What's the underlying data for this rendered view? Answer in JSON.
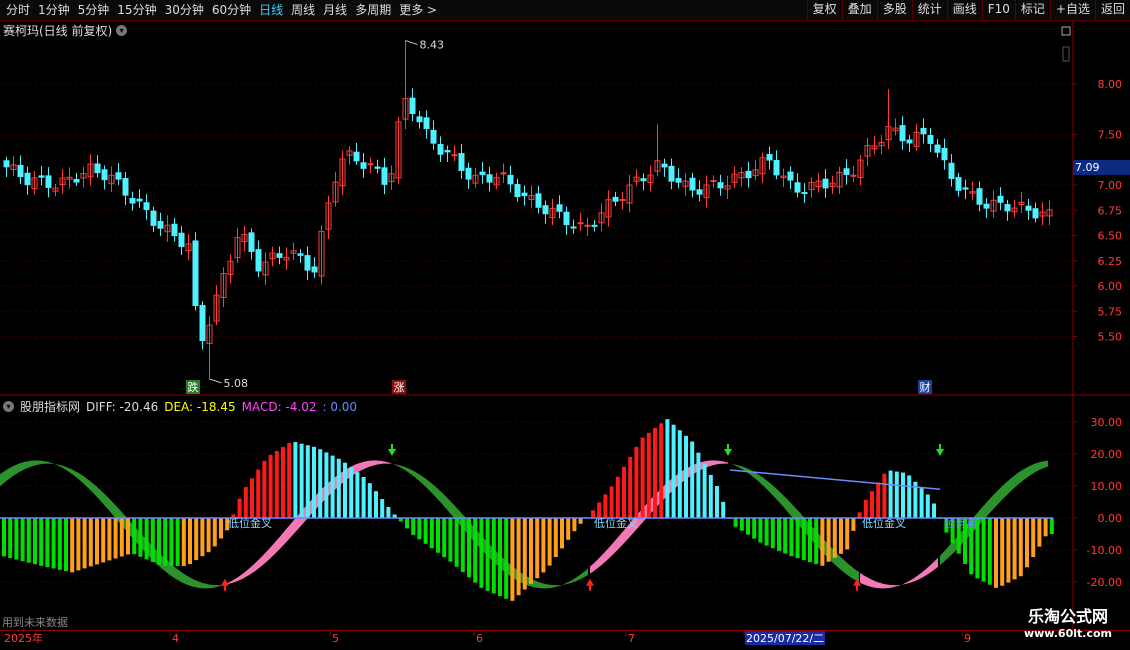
{
  "toolbar": {
    "periods": [
      "分时",
      "1分钟",
      "5分钟",
      "15分钟",
      "30分钟",
      "60分钟",
      "日线",
      "周线",
      "月线",
      "多周期",
      "更多 >"
    ],
    "active_period": "日线",
    "right_tools": [
      "复权",
      "叠加",
      "多股",
      "统计",
      "画线",
      "F10",
      "标记",
      "+自选",
      "返回"
    ]
  },
  "stock": {
    "title": "赛柯玛(日线 前复权)",
    "last_price": "7.09"
  },
  "price_axis": [
    "8.00",
    "7.50",
    "7.00",
    "6.75",
    "6.50",
    "6.25",
    "6.00",
    "5.75",
    "5.50"
  ],
  "markers": {
    "high_label": "8.43",
    "low_label": "5.08",
    "tags": [
      "跌",
      "涨",
      "财"
    ]
  },
  "indicator": {
    "name": "股朋指标网",
    "diff_label": "DIFF: -20.46",
    "dea_label": "DEA: -18.45",
    "macd_label": "MACD: -4.02",
    "extra_label": ": 0.00"
  },
  "macd_axis": [
    "30.00",
    "20.00",
    "10.00",
    "0.00",
    "-10.00",
    "-20.00"
  ],
  "macd_signals": [
    "低位金叉",
    "低位金叉",
    "低位金叉",
    "顶背离"
  ],
  "date_axis": {
    "labels": [
      "2025年",
      "4",
      "5",
      "6",
      "7",
      "2025/07/22/二",
      "9"
    ]
  },
  "footer": {
    "note": "用到未来数据"
  },
  "watermark": {
    "title": "乐淘公式网",
    "url": "www.60lt.com"
  },
  "colors": {
    "up": "#ff3b3b",
    "down": "#4ff0ff",
    "pos_bar": "#ff1a1a",
    "pos_bar2": "#4ff0ff",
    "neg_bar": "#00e000",
    "neg_bar2": "#ff9f1a",
    "band_up": "#ff7fbf",
    "band_down": "#2e9a2e"
  }
}
